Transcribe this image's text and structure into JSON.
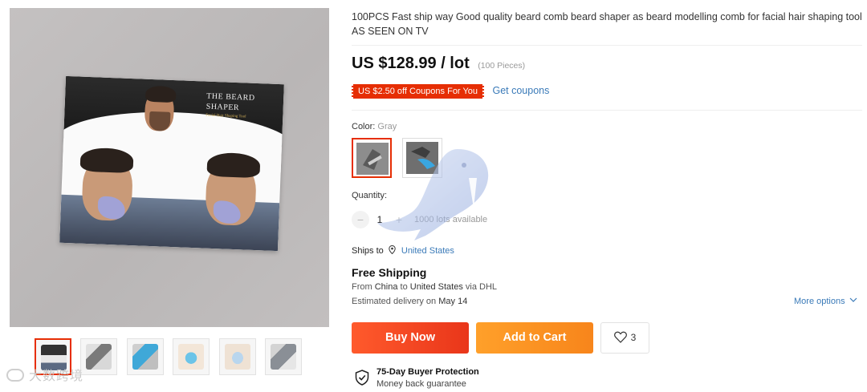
{
  "product": {
    "title": "100PCS Fast ship way Good quality beard comb beard shaper as beard modelling comb for facial hair shaping tool AS SEEN ON TV",
    "price": "US $128.99 / lot",
    "pieces": "(100 Pieces)",
    "coupon_badge": "US $2.50 off Coupons For You",
    "coupon_link": "Get coupons"
  },
  "main_image": {
    "card_title": "THE BEARD SHAPER",
    "card_subtitle": "Facial Hair Shaping Tool"
  },
  "variants": {
    "color_label": "Color:",
    "color_value": "Gray",
    "swatches": [
      {
        "name": "Gray",
        "selected": true
      },
      {
        "name": "Blue",
        "selected": false
      }
    ]
  },
  "quantity": {
    "label": "Quantity:",
    "minus": "−",
    "value": "1",
    "plus": "+",
    "available": "1000 lots available"
  },
  "shipping": {
    "ships_to_label": "Ships to",
    "ships_to_country": "United States",
    "free_shipping": "Free Shipping",
    "from_prefix": "From",
    "from_country": "China",
    "to_word": "to",
    "to_country": "United States",
    "via": "via DHL",
    "estimated_prefix": "Estimated delivery on",
    "estimated_date": "May 14",
    "more_options": "More options"
  },
  "actions": {
    "buy_now": "Buy Now",
    "add_to_cart": "Add to Cart",
    "wishlist_count": "3"
  },
  "protection": {
    "title": "75-Day Buyer Protection",
    "subtitle": "Money back guarantee"
  },
  "watermark": {
    "text": "大数跨境"
  },
  "colors": {
    "accent_red": "#e62e04",
    "buy_orange": "#ff5a2c",
    "cart_orange": "#ffa02a",
    "link_blue": "#3a7ab8"
  }
}
